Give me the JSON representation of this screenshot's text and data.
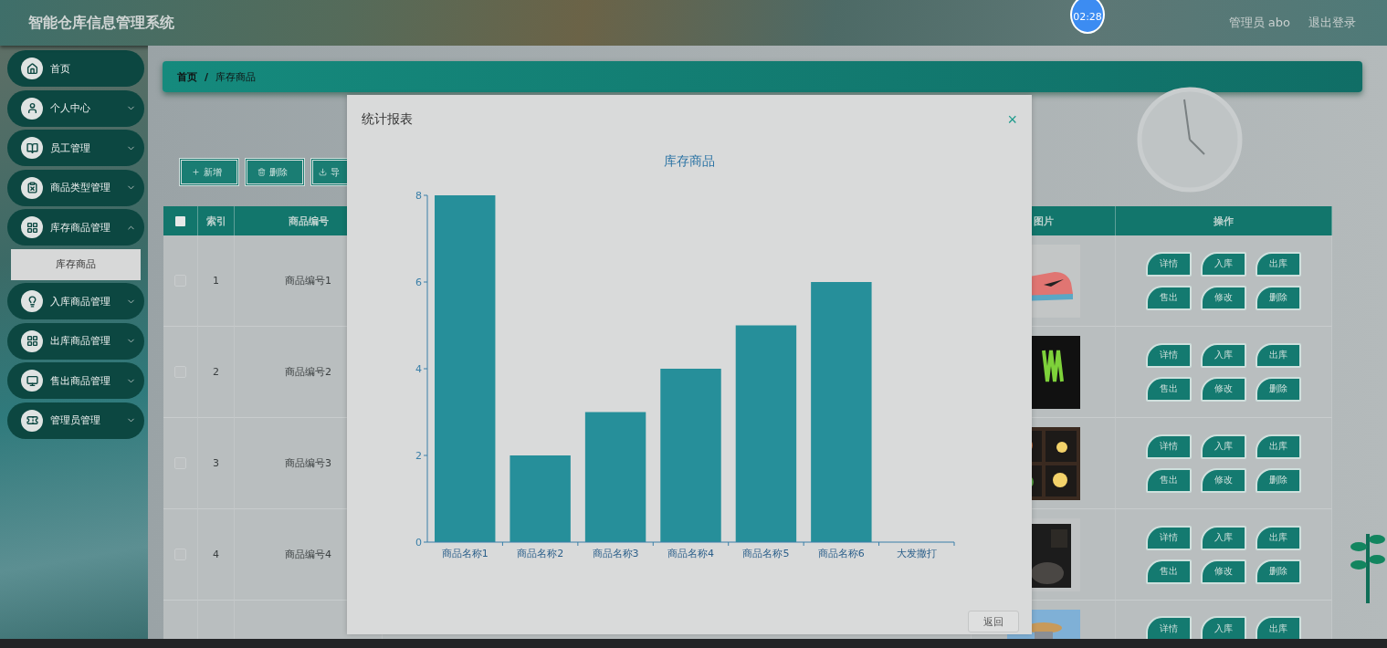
{
  "header": {
    "title": "智能仓库信息管理系统",
    "timer": "02:28",
    "user": "管理员 abo",
    "logout": "退出登录"
  },
  "sidebar": {
    "items": [
      {
        "label": "首页",
        "kind": "link"
      },
      {
        "label": "个人中心",
        "kind": "menu",
        "expanded": false
      },
      {
        "label": "员工管理",
        "kind": "menu",
        "expanded": false
      },
      {
        "label": "商品类型管理",
        "kind": "menu",
        "expanded": false
      },
      {
        "label": "库存商品管理",
        "kind": "menu",
        "expanded": true,
        "children": [
          {
            "label": "库存商品",
            "selected": true
          }
        ]
      },
      {
        "label": "入库商品管理",
        "kind": "menu",
        "expanded": false
      },
      {
        "label": "出库商品管理",
        "kind": "menu",
        "expanded": false
      },
      {
        "label": "售出商品管理",
        "kind": "menu",
        "expanded": false
      },
      {
        "label": "管理员管理",
        "kind": "menu",
        "expanded": false
      }
    ]
  },
  "breadcrumb": {
    "items": [
      "首页",
      "库存商品"
    ],
    "separator": "/"
  },
  "toolbar": [
    {
      "label": "新增",
      "kind": "add"
    },
    {
      "label": "删除",
      "kind": "delete"
    },
    {
      "label": "导",
      "kind": "export"
    }
  ],
  "table": {
    "select_all": false,
    "columns": [
      "索引",
      "商品编号",
      "图片",
      "操作"
    ],
    "rows": [
      {
        "checked": false,
        "index": "1",
        "code": "商品编号1",
        "actions": [
          "详情",
          "入库",
          "出库",
          "售出",
          "修改",
          "删除"
        ]
      },
      {
        "checked": false,
        "index": "2",
        "code": "商品编号2",
        "actions": [
          "详情",
          "入库",
          "出库",
          "售出",
          "修改",
          "删除"
        ]
      },
      {
        "checked": false,
        "index": "3",
        "code": "商品编号3",
        "actions": [
          "详情",
          "入库",
          "出库",
          "售出",
          "修改",
          "删除"
        ]
      },
      {
        "checked": false,
        "index": "4",
        "code": "商品编号4",
        "actions": [
          "详情",
          "入库",
          "出库",
          "售出",
          "修改",
          "删除"
        ]
      },
      {
        "actions": [
          "详情",
          "入库",
          "出库"
        ]
      }
    ]
  },
  "dialog": {
    "title": "统计报表",
    "close": "×",
    "back_button": "返回",
    "chart_data": {
      "type": "bar",
      "title": "库存商品",
      "categories": [
        "商品名称1",
        "商品名称2",
        "商品名称3",
        "商品名称4",
        "商品名称5",
        "商品名称6",
        "大发撒打"
      ],
      "values": [
        8,
        2,
        3,
        4,
        5,
        6,
        0
      ],
      "ylim": [
        0,
        8
      ],
      "yticks": [
        0,
        2,
        4,
        6,
        8
      ]
    }
  }
}
